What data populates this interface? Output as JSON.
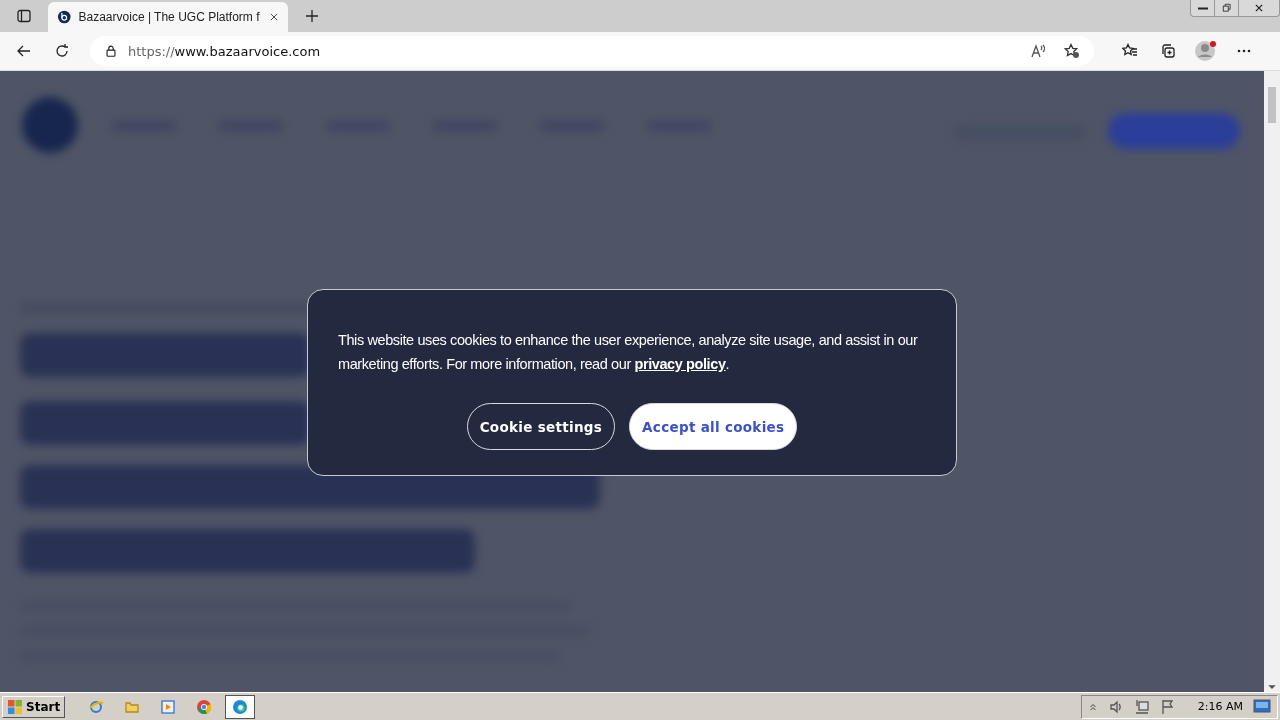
{
  "browser": {
    "tab": {
      "title": "Bazaarvoice | The UGC Platform f",
      "selected": true
    },
    "url_scheme": "https://",
    "url_host": "www.bazaarvoice.com"
  },
  "cookie_dialog": {
    "message": "This website uses cookies to enhance the user experience, analyze site usage, and assist in our marketing efforts. For more information, read our ",
    "link": "privacy policy",
    "after_link": ".",
    "buttons": [
      {
        "label": "Cookie settings",
        "kind": "outline"
      },
      {
        "label": "Accept all cookies",
        "kind": "filled"
      }
    ]
  },
  "taskbar": {
    "start": "Start",
    "apps": [
      {
        "kind": "ie",
        "selected": false
      },
      {
        "kind": "folder",
        "selected": false
      },
      {
        "kind": "media",
        "selected": false
      },
      {
        "kind": "chrome",
        "selected": false
      },
      {
        "kind": "edge",
        "selected": true
      }
    ],
    "clock": "2:16 AM"
  }
}
